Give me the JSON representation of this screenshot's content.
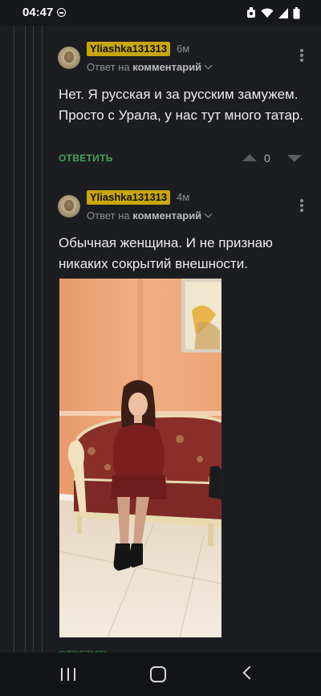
{
  "status_bar": {
    "time": "04:47",
    "icons": [
      "dnd-icon",
      "alarm-icon",
      "wifi-icon",
      "signal-icon",
      "battery-icon"
    ]
  },
  "comments": [
    {
      "username": "Yliashka131313",
      "time_ago": "6м",
      "reply_prefix": "Ответ на",
      "reply_target": "комментарий",
      "text": "Нет. Я русская и за русским замужем. Просто с Урала, у нас тут много татар.",
      "reply_label": "ОТВЕТИТЬ",
      "rating": "0"
    },
    {
      "username": "Yliashka131313",
      "time_ago": "4м",
      "reply_prefix": "Ответ на",
      "reply_target": "комментарий",
      "text": "Обычная женщина. И не признаю никаких сокрытий внешности.",
      "has_photo": true,
      "reply_label": "ОТВЕТИТЬ"
    }
  ],
  "colors": {
    "background": "#1c1d21",
    "username_badge": "#c8a60e",
    "reply_green": "#4aa35a",
    "muted_text": "#8e8f94"
  },
  "nav_bar": {
    "icons": [
      "recent-apps-icon",
      "home-icon",
      "back-icon"
    ]
  }
}
